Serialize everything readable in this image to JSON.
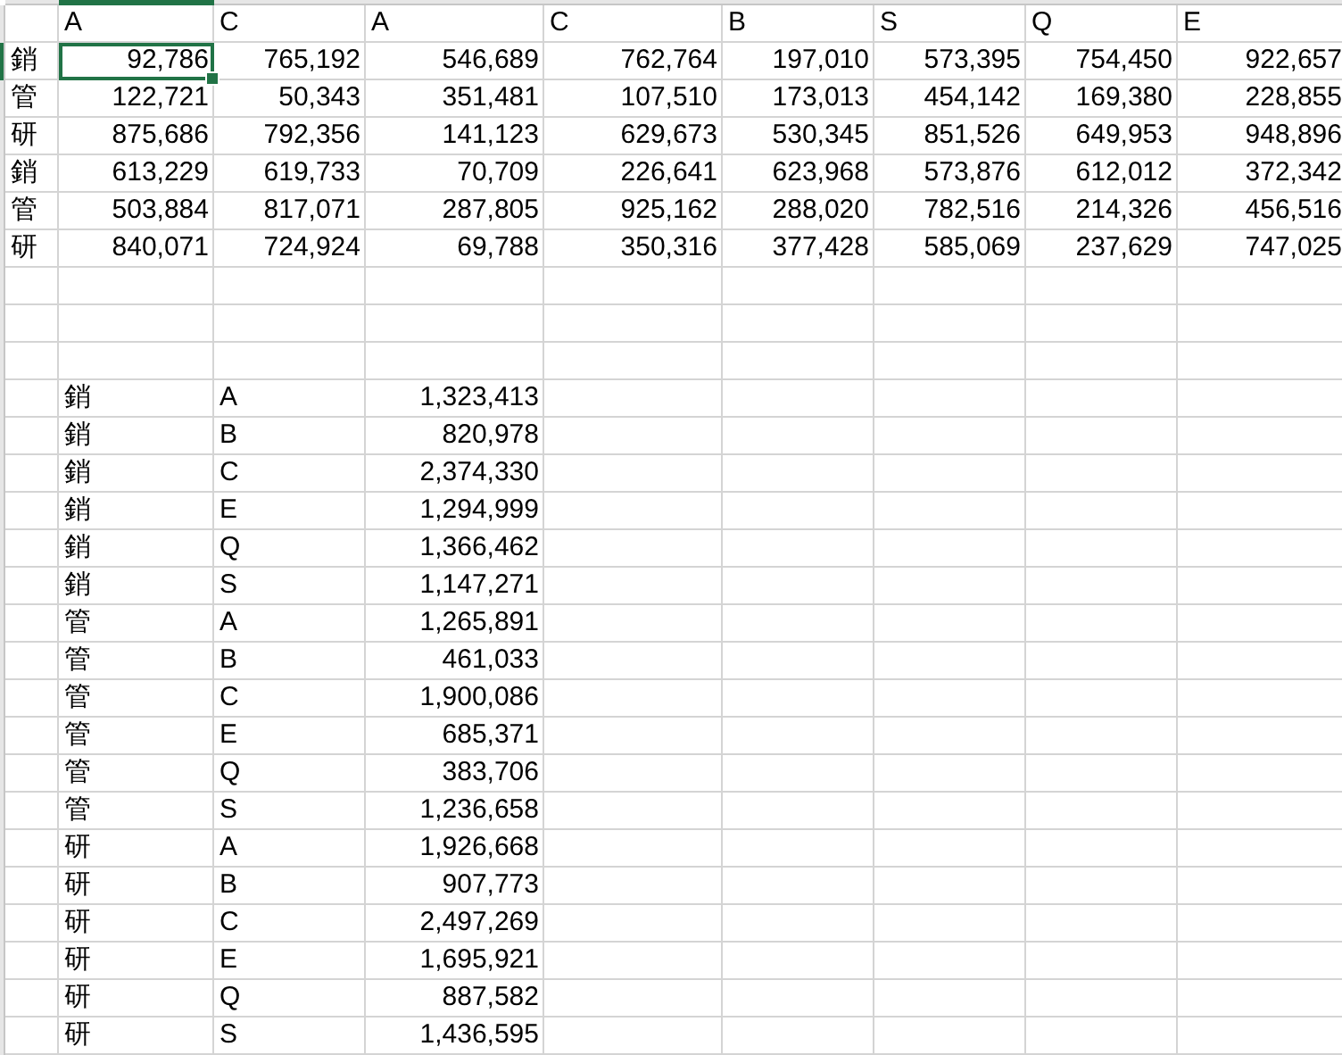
{
  "sheet": {
    "header_row": [
      "A",
      "C",
      "A",
      "C",
      "B",
      "S",
      "Q",
      "E"
    ],
    "rows": [
      {
        "label": "銷",
        "cells": [
          {
            "text": "92,786",
            "selected": true
          },
          {
            "text": "765,192",
            "selected": false
          },
          {
            "text": "546,689",
            "selected": false
          },
          {
            "text": "762,764",
            "selected": false
          },
          {
            "text": "197,010",
            "selected": false
          },
          {
            "text": "573,395",
            "selected": false
          },
          {
            "text": "754,450",
            "selected": false
          },
          {
            "text": "922,657",
            "selected": false
          }
        ]
      },
      {
        "label": "管",
        "cells": [
          {
            "text": "122,721",
            "selected": false
          },
          {
            "text": "50,343",
            "selected": false
          },
          {
            "text": "351,481",
            "selected": false
          },
          {
            "text": "107,510",
            "selected": false
          },
          {
            "text": "173,013",
            "selected": false
          },
          {
            "text": "454,142",
            "selected": false
          },
          {
            "text": "169,380",
            "selected": false
          },
          {
            "text": "228,855",
            "selected": false
          }
        ]
      },
      {
        "label": "研",
        "cells": [
          {
            "text": "875,686",
            "selected": false
          },
          {
            "text": "792,356",
            "selected": false
          },
          {
            "text": "141,123",
            "selected": false
          },
          {
            "text": "629,673",
            "selected": false
          },
          {
            "text": "530,345",
            "selected": false
          },
          {
            "text": "851,526",
            "selected": false
          },
          {
            "text": "649,953",
            "selected": false
          },
          {
            "text": "948,896",
            "selected": false
          }
        ]
      },
      {
        "label": "銷",
        "cells": [
          {
            "text": "613,229",
            "selected": false
          },
          {
            "text": "619,733",
            "selected": false
          },
          {
            "text": "70,709",
            "selected": false
          },
          {
            "text": "226,641",
            "selected": false
          },
          {
            "text": "623,968",
            "selected": false
          },
          {
            "text": "573,876",
            "selected": false
          },
          {
            "text": "612,012",
            "selected": false
          },
          {
            "text": "372,342",
            "selected": false
          }
        ]
      },
      {
        "label": "管",
        "cells": [
          {
            "text": "503,884",
            "selected": false
          },
          {
            "text": "817,071",
            "selected": false
          },
          {
            "text": "287,805",
            "selected": false
          },
          {
            "text": "925,162",
            "selected": false
          },
          {
            "text": "288,020",
            "selected": false
          },
          {
            "text": "782,516",
            "selected": false
          },
          {
            "text": "214,326",
            "selected": false
          },
          {
            "text": "456,516",
            "selected": false
          }
        ]
      },
      {
        "label": "研",
        "cells": [
          {
            "text": "840,071",
            "selected": false
          },
          {
            "text": "724,924",
            "selected": false
          },
          {
            "text": "69,788",
            "selected": false
          },
          {
            "text": "350,316",
            "selected": false
          },
          {
            "text": "377,428",
            "selected": false
          },
          {
            "text": "585,069",
            "selected": false
          },
          {
            "text": "237,629",
            "selected": false
          },
          {
            "text": "747,025",
            "selected": false
          }
        ]
      }
    ],
    "summary_rows": [
      [
        "銷",
        "A",
        "1,323,413"
      ],
      [
        "銷",
        "B",
        "820,978"
      ],
      [
        "銷",
        "C",
        "2,374,330"
      ],
      [
        "銷",
        "E",
        "1,294,999"
      ],
      [
        "銷",
        "Q",
        "1,366,462"
      ],
      [
        "銷",
        "S",
        "1,147,271"
      ],
      [
        "管",
        "A",
        "1,265,891"
      ],
      [
        "管",
        "B",
        "461,033"
      ],
      [
        "管",
        "C",
        "1,900,086"
      ],
      [
        "管",
        "E",
        "685,371"
      ],
      [
        "管",
        "Q",
        "383,706"
      ],
      [
        "管",
        "S",
        "1,236,658"
      ],
      [
        "研",
        "A",
        "1,926,668"
      ],
      [
        "研",
        "B",
        "907,773"
      ],
      [
        "研",
        "C",
        "2,497,269"
      ],
      [
        "研",
        "E",
        "1,695,921"
      ],
      [
        "研",
        "Q",
        "887,582"
      ],
      [
        "研",
        "S",
        "1,436,595"
      ]
    ]
  }
}
